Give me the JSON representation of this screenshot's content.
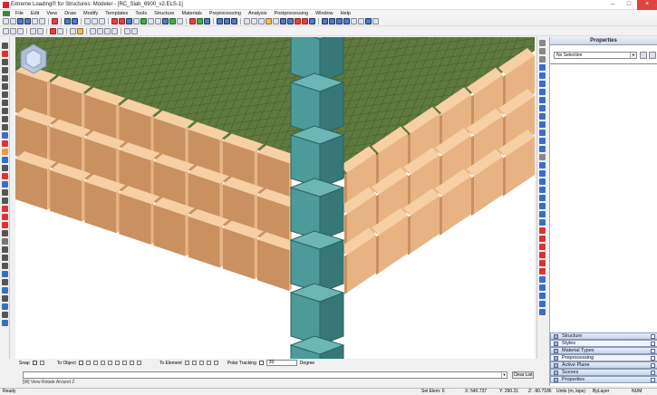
{
  "window": {
    "title": "Extreme Loading® for Structures: Modeler - [RC_Slab_6900_v2.ELS-1]",
    "min_glyph": "–",
    "max_glyph": "□",
    "close_glyph": "×"
  },
  "menu": [
    "File",
    "Edit",
    "View",
    "Draw",
    "Modify",
    "Templates",
    "Tools",
    "Structure",
    "Materials",
    "Preprocessing",
    "Analysis",
    "Postprocessing",
    "Window",
    "Help"
  ],
  "properties_panel": {
    "title": "Properties",
    "selection": "No Selection",
    "panels": [
      {
        "label": "Structure",
        "style": "normal"
      },
      {
        "label": "Styles",
        "style": "sub"
      },
      {
        "label": "Material Types",
        "style": "normal"
      },
      {
        "label": "Preprocessing",
        "style": "sub"
      },
      {
        "label": "Active Plane",
        "style": "normal"
      },
      {
        "label": "Scenes",
        "style": "normal"
      },
      {
        "label": "Properties",
        "style": "normal"
      }
    ]
  },
  "snap_bar": {
    "snap_label": "Snap",
    "to_object_label": "To Object",
    "to_element_label": "To Element",
    "polar_tracking_label": "Polar Tracking",
    "polar_value": "30",
    "degree_label": "Degree"
  },
  "command": {
    "clear_list_label": "Clear List",
    "history_text": "[W] View Rotate Around Z"
  },
  "status_bar": {
    "mode": "Ready",
    "sel_elem": "Sel Elem: 0",
    "x": "X: 540.737",
    "y": "Y: 290.21",
    "z": "Z: -90.7186",
    "units": "Units (m, kips)",
    "layer": "ByLayer",
    "num": "NUM"
  },
  "colors": {
    "slab_top": "#5f7a3e",
    "slab_grid": "#44592b",
    "brick_front": "#c9915f",
    "brick_side": "#e8b383",
    "brick_edge": "#f6cfa5",
    "column_face": "#4c9a9a",
    "column_side": "#367878",
    "column_top": "#6cb6b6"
  }
}
